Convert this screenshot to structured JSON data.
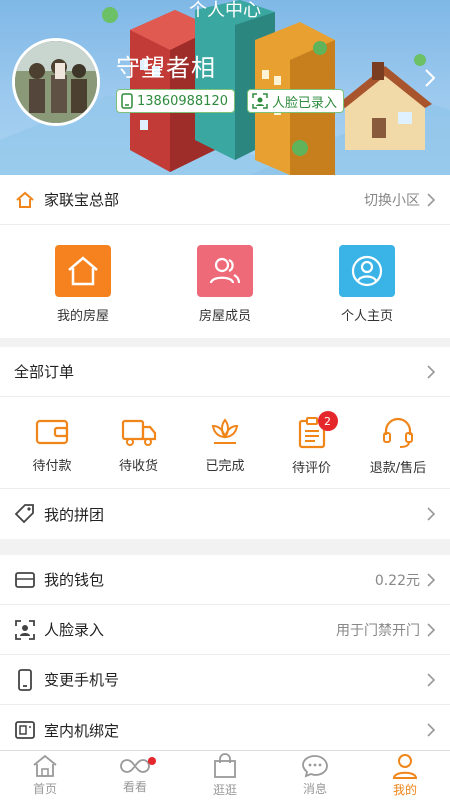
{
  "header": {
    "title": "个人中心",
    "user_name": "守望者相",
    "phone": "13860988120",
    "face_status": "人脸已录入"
  },
  "community": {
    "name": "家联宝总部",
    "switch_label": "切换小区"
  },
  "house_menu": [
    {
      "label": "我的房屋",
      "icon": "house-icon",
      "color": "#f6821f"
    },
    {
      "label": "房屋成员",
      "icon": "members-icon",
      "color": "#ee6a78"
    },
    {
      "label": "个人主页",
      "icon": "profile-icon",
      "color": "#3ab4e6"
    }
  ],
  "orders": {
    "title": "全部订单",
    "items": [
      {
        "label": "待付款",
        "icon": "wallet-icon"
      },
      {
        "label": "待收货",
        "icon": "truck-icon"
      },
      {
        "label": "已完成",
        "icon": "lotus-icon"
      },
      {
        "label": "待评价",
        "icon": "clipboard-icon",
        "badge": "2"
      },
      {
        "label": "退款/售后",
        "icon": "headset-icon"
      }
    ]
  },
  "group_buy": {
    "label": "我的拼团"
  },
  "wallet": {
    "label": "我的钱包",
    "value": "0.22元"
  },
  "face_entry": {
    "label": "人脸录入",
    "value": "用于门禁开门"
  },
  "change_phone": {
    "label": "变更手机号"
  },
  "indoor_bind": {
    "label": "室内机绑定"
  },
  "tabs": [
    {
      "label": "首页",
      "icon": "home-icon"
    },
    {
      "label": "看看",
      "icon": "infinity-icon",
      "dot": true
    },
    {
      "label": "逛逛",
      "icon": "shopping-bag-icon"
    },
    {
      "label": "消息",
      "icon": "message-icon"
    },
    {
      "label": "我的",
      "icon": "person-icon",
      "active": true
    }
  ],
  "colors": {
    "accent": "#f08519",
    "badge": "#e5262b",
    "chip_text": "#2e8b3c"
  }
}
